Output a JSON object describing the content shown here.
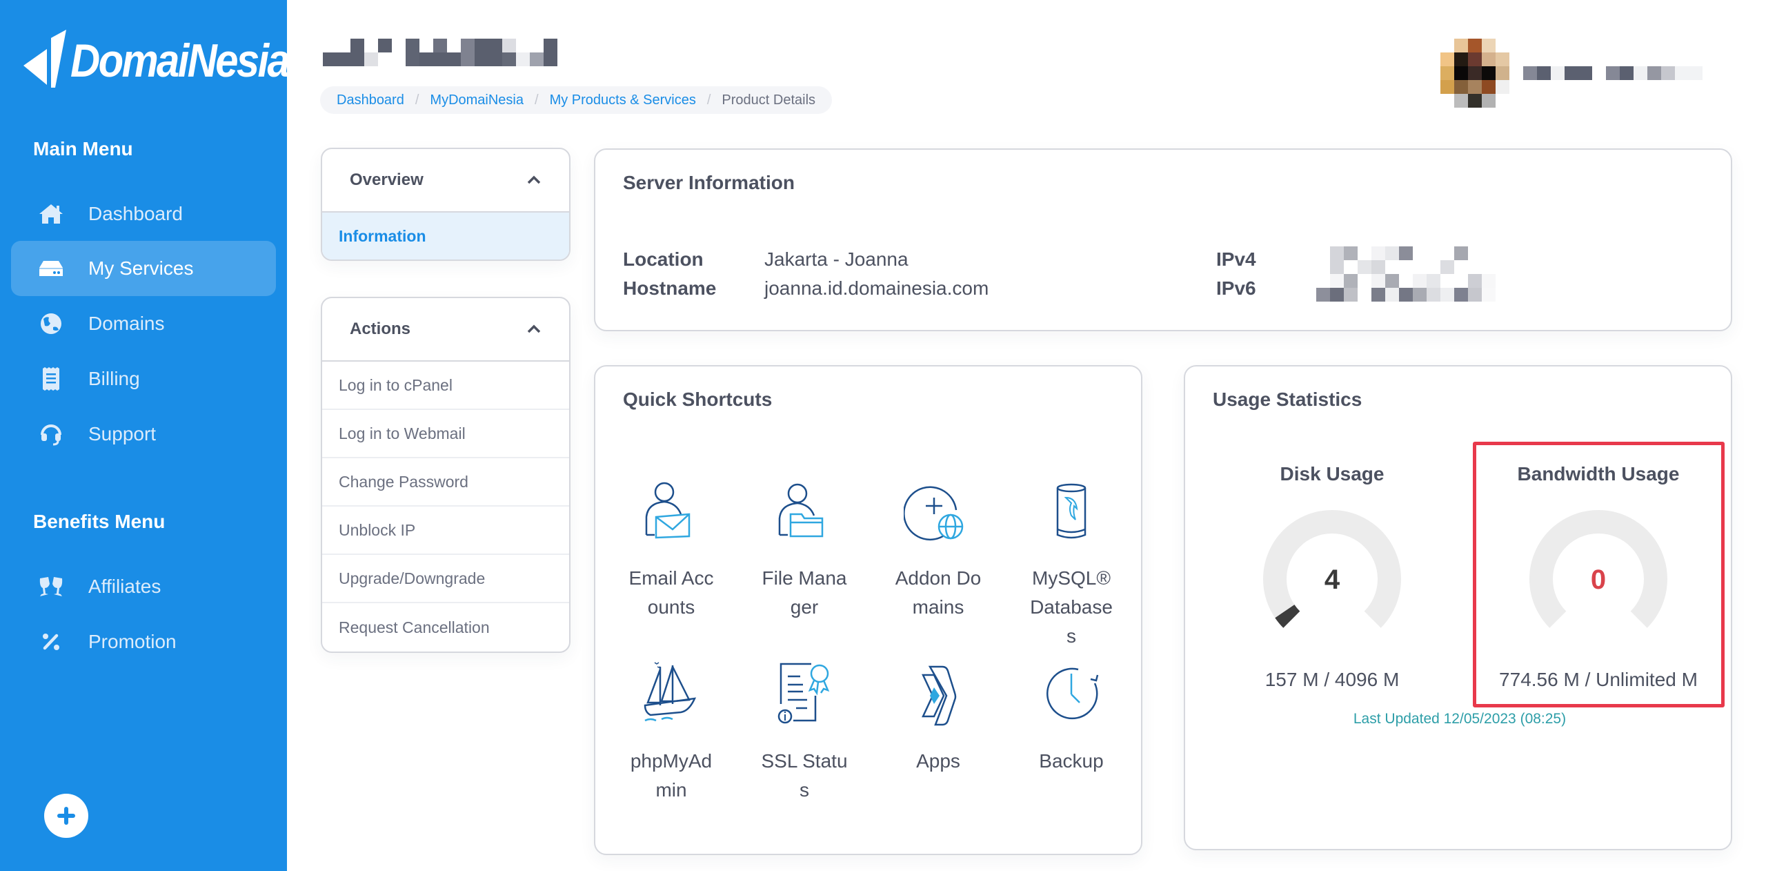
{
  "brand": {
    "name": "DomaiNesia",
    "primary_color": "#1a8de6"
  },
  "sidebar": {
    "main_menu_heading": "Main Menu",
    "main_items": [
      {
        "label": "Dashboard",
        "icon": "home-icon",
        "active": false
      },
      {
        "label": "My Services",
        "icon": "server-icon",
        "active": true
      },
      {
        "label": "Domains",
        "icon": "globe-icon",
        "active": false
      },
      {
        "label": "Billing",
        "icon": "receipt-icon",
        "active": false
      },
      {
        "label": "Support",
        "icon": "headset-icon",
        "active": false
      }
    ],
    "benefits_menu_heading": "Benefits Menu",
    "benefit_items": [
      {
        "label": "Affiliates",
        "icon": "glasses-cheers-icon"
      },
      {
        "label": "Promotion",
        "icon": "percent-icon"
      }
    ],
    "add_button_icon": "plus-icon"
  },
  "header": {
    "title_redacted": true,
    "user_redacted": true
  },
  "breadcrumb": {
    "items": [
      "Dashboard",
      "MyDomaiNesia",
      "My Products & Services"
    ],
    "current": "Product Details",
    "separator": "/"
  },
  "overview_panel": {
    "title": "Overview",
    "items": [
      "Information"
    ]
  },
  "actions_panel": {
    "title": "Actions",
    "items": [
      "Log in to cPanel",
      "Log in to Webmail",
      "Change Password",
      "Unblock IP",
      "Upgrade/Downgrade",
      "Request Cancellation"
    ]
  },
  "server_info": {
    "title": "Server Information",
    "location_label": "Location",
    "location_value": "Jakarta - Joanna",
    "hostname_label": "Hostname",
    "hostname_value": "joanna.id.domainesia.com",
    "ipv4_label": "IPv4",
    "ipv6_label": "IPv6",
    "ip_values_redacted": true
  },
  "quick_shortcuts": {
    "title": "Quick Shortcuts",
    "items": [
      {
        "label": "Email Accounts",
        "icon": "email-accounts-icon"
      },
      {
        "label": "File Manager",
        "icon": "file-manager-icon"
      },
      {
        "label": "Addon Domains",
        "icon": "addon-domains-icon"
      },
      {
        "label": "MySQL® Databases",
        "icon": "mysql-database-icon"
      },
      {
        "label": "phpMyAdmin",
        "icon": "phpmyadmin-icon"
      },
      {
        "label": "SSL Status",
        "icon": "ssl-certificate-icon"
      },
      {
        "label": "Apps",
        "icon": "apps-icon"
      },
      {
        "label": "Backup",
        "icon": "backup-clock-icon"
      }
    ]
  },
  "usage_statistics": {
    "title": "Usage Statistics",
    "disk": {
      "title": "Disk Usage",
      "percent": 4,
      "used": "157 M",
      "limit": "4096 M",
      "summary": "157 M / 4096 M",
      "value_color": "#3a3a3a"
    },
    "bandwidth": {
      "title": "Bandwidth Usage",
      "percent": 0,
      "used": "774.56 M",
      "limit": "Unlimited M",
      "summary": "774.56 M / Unlimited M",
      "value_color": "#d9434b",
      "highlighted": true
    },
    "last_updated": "Last Updated 12/05/2023 (08:25)"
  }
}
